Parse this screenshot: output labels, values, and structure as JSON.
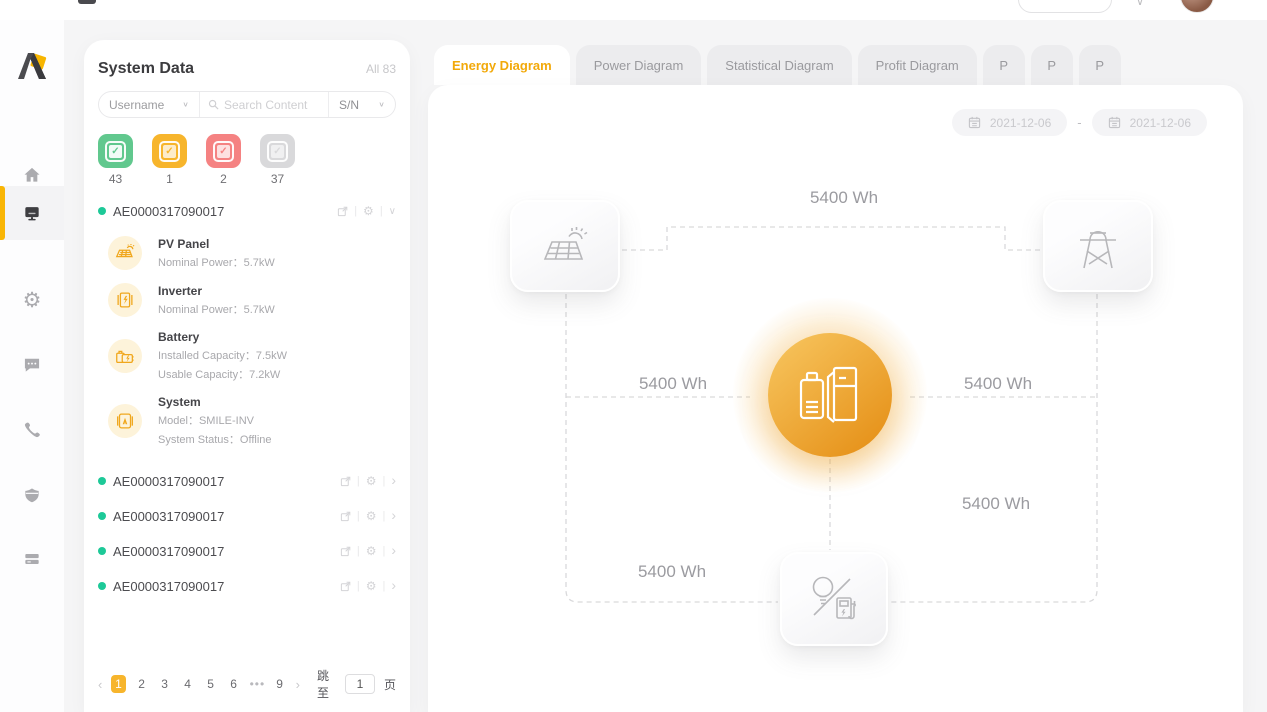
{
  "colors": {
    "accent": "#f7b500",
    "green": "#61c88e",
    "yellow": "#f7b52c",
    "red": "#f58282",
    "gray": "#d9d9db",
    "orange_core": "#e6921a"
  },
  "sidebar": {
    "items": [
      {
        "icon": "home-icon",
        "active": false
      },
      {
        "icon": "device-monitor-icon",
        "active": true
      },
      {
        "icon": "gear-icon",
        "active": false
      },
      {
        "icon": "chat-icon",
        "active": false
      },
      {
        "icon": "phone-icon",
        "active": false
      },
      {
        "icon": "shield-icon",
        "active": false
      },
      {
        "icon": "card-list-icon",
        "active": false
      }
    ]
  },
  "system_panel": {
    "title": "System Data",
    "total": "All 83",
    "search": {
      "field": "Username",
      "placeholder": "Search Content",
      "sn": "S/N"
    },
    "statuses": [
      {
        "status": "normal",
        "count": "43"
      },
      {
        "status": "warning",
        "count": "1"
      },
      {
        "status": "fault",
        "count": "2"
      },
      {
        "status": "offline",
        "count": "37"
      }
    ],
    "expanded_device": {
      "serial": "AE0000317090017",
      "components": [
        {
          "icon": "solar-panel-icon",
          "name": "PV Panel",
          "line1": "Nominal Power：5.7kW"
        },
        {
          "icon": "inverter-icon",
          "name": "Inverter",
          "line1": "Nominal Power：5.7kW"
        },
        {
          "icon": "battery-icon",
          "name": "Battery",
          "line1": "Installed Capacity：7.5kW",
          "line2": "Usable Capacity：7.2kW"
        },
        {
          "icon": "system-icon",
          "name": "System",
          "line1": "Model：SMILE-INV",
          "line2": "System Status：Offline"
        }
      ]
    },
    "devices": [
      {
        "serial": "AE0000317090017"
      },
      {
        "serial": "AE0000317090017"
      },
      {
        "serial": "AE0000317090017"
      },
      {
        "serial": "AE0000317090017"
      }
    ],
    "pagination": {
      "prev": "‹",
      "next": "›",
      "pages": [
        "1",
        "2",
        "3",
        "4",
        "5",
        "6",
        "•••",
        "9"
      ],
      "active_page": "1",
      "jump_label": "跳至",
      "jump_value": "1",
      "page_unit": "页"
    }
  },
  "main": {
    "tabs": [
      {
        "label": "Energy Diagram",
        "active": true
      },
      {
        "label": "Power Diagram",
        "active": false
      },
      {
        "label": "Statistical Diagram",
        "active": false
      },
      {
        "label": "Profit Diagram",
        "active": false
      },
      {
        "label": "P",
        "active": false
      },
      {
        "label": "P",
        "active": false
      },
      {
        "label": "P",
        "active": false
      }
    ],
    "date_start": "2021-12-06",
    "date_separator": "-",
    "date_end": "2021-12-06",
    "diagram": {
      "nodes": [
        "pv-panel",
        "grid",
        "battery-inverter",
        "load"
      ],
      "flows": {
        "pv_to_grid": "5400 Wh",
        "pv_to_battery": "5400 Wh",
        "battery_to_grid": "5400 Wh",
        "grid_to_load": "5400 Wh",
        "pv_to_load": "5400 Wh"
      }
    }
  }
}
